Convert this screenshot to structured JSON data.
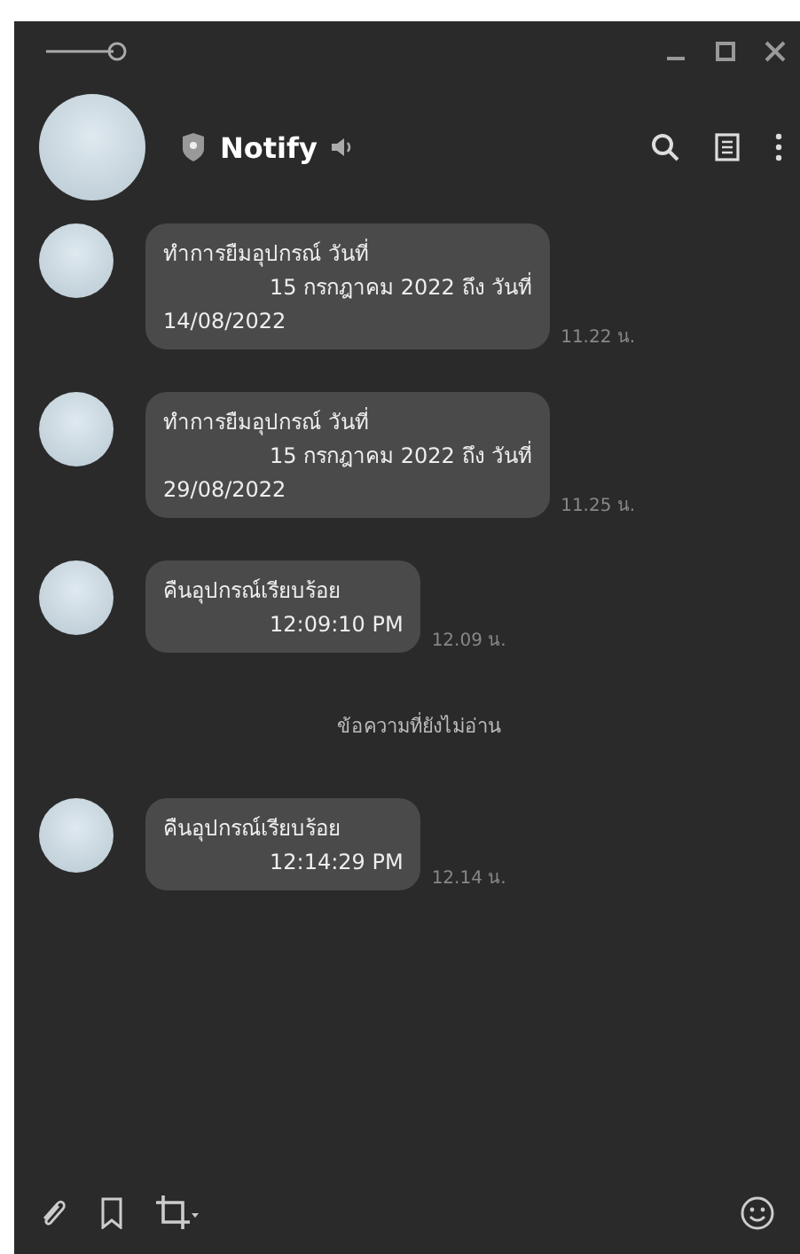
{
  "chat": {
    "name": "Notify"
  },
  "messages": [
    {
      "kind": "message",
      "lines": [
        {
          "text": "ทำการยืมอุปกรณ์ วันที่",
          "indented": false
        },
        {
          "text": "15 กรกฎาคม 2022 ถึง วันที่",
          "indented": true
        },
        {
          "text": "14/08/2022",
          "indented": false
        }
      ],
      "time": "11.22 น."
    },
    {
      "kind": "message",
      "lines": [
        {
          "text": "ทำการยืมอุปกรณ์ วันที่",
          "indented": false
        },
        {
          "text": "15 กรกฎาคม 2022 ถึง วันที่",
          "indented": true
        },
        {
          "text": "29/08/2022",
          "indented": false
        }
      ],
      "time": "11.25 น."
    },
    {
      "kind": "message",
      "lines": [
        {
          "text": "คืนอุปกรณ์เรียบร้อย",
          "indented": false
        },
        {
          "text": "12:09:10 PM",
          "indented": true
        }
      ],
      "time": "12.09 น."
    },
    {
      "kind": "divider",
      "text": "ข้อความที่ยังไม่อ่าน"
    },
    {
      "kind": "message",
      "lines": [
        {
          "text": "คืนอุปกรณ์เรียบร้อย",
          "indented": false
        },
        {
          "text": "12:14:29 PM",
          "indented": true
        }
      ],
      "time": "12.14 น."
    }
  ]
}
